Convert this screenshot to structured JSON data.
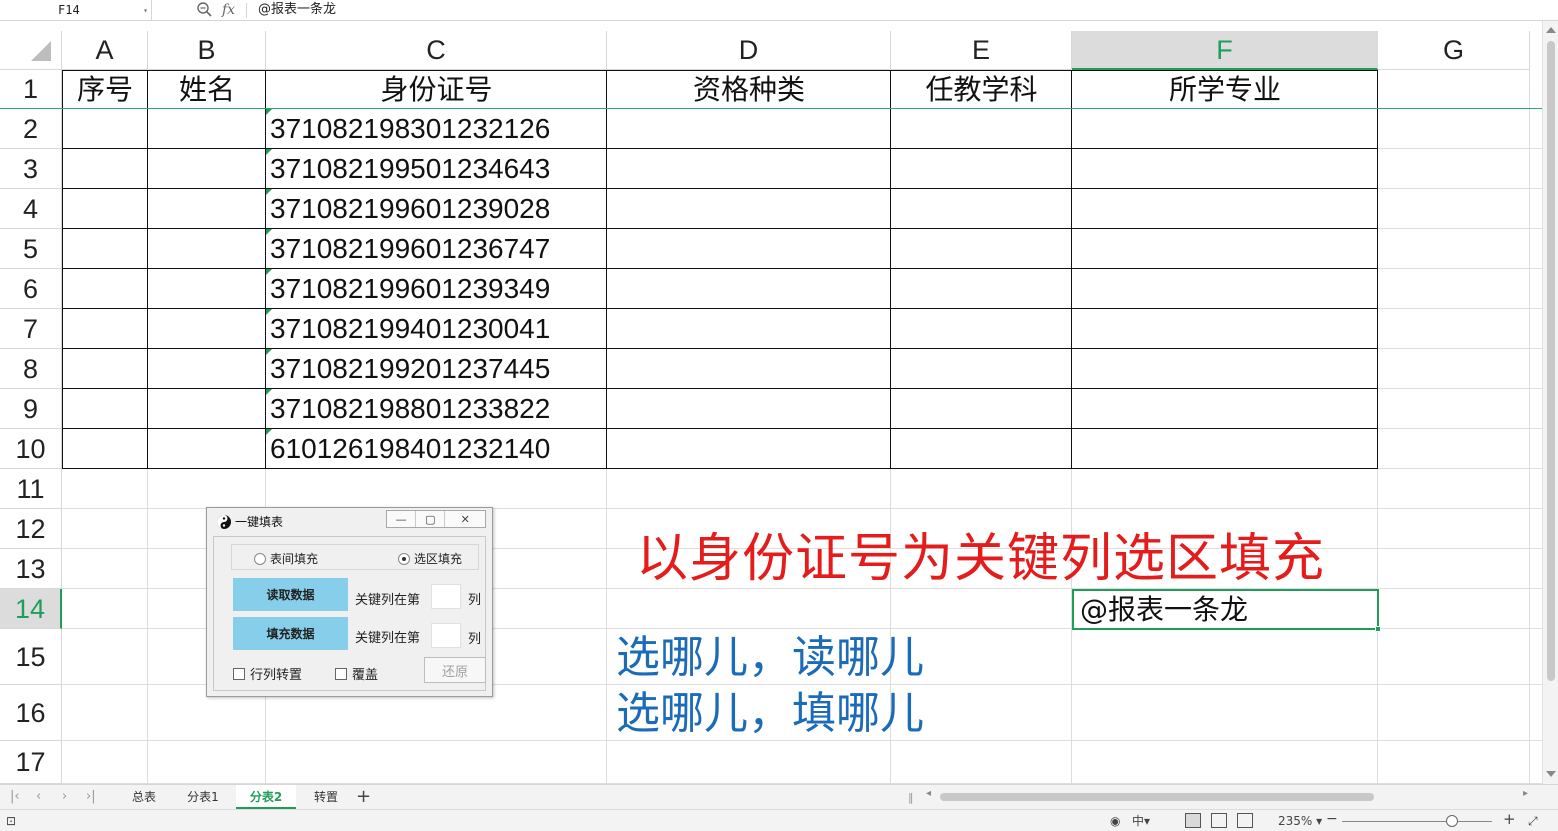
{
  "formula_bar": {
    "cell_ref": "F14",
    "fx_label": "fx",
    "content": "@报表一条龙"
  },
  "columns": [
    "A",
    "B",
    "C",
    "D",
    "E",
    "F",
    "G"
  ],
  "active_column": "F",
  "rows": [
    "1",
    "2",
    "3",
    "4",
    "5",
    "6",
    "7",
    "8",
    "9",
    "10",
    "11",
    "12",
    "13",
    "14",
    "15",
    "16",
    "17"
  ],
  "active_row": "14",
  "table": {
    "headers": [
      "序号",
      "姓名",
      "身份证号",
      "资格种类",
      "任教学科",
      "所学专业"
    ],
    "id_numbers": [
      "371082198301232126",
      "371082199501234643",
      "371082199601239028",
      "371082199601236747",
      "371082199601239349",
      "371082199401230041",
      "371082199201237445",
      "371082198801233822",
      "610126198401232140"
    ]
  },
  "annotations": {
    "title_red": "以身份证号为关键列选区填充",
    "line1": "选哪儿，读哪儿",
    "line2": "选哪儿，填哪儿",
    "selected_cell_text": "@报表一条龙"
  },
  "dialog": {
    "title": "一键填表",
    "radio_options": [
      {
        "label": "表间填充",
        "checked": false
      },
      {
        "label": "选区填充",
        "checked": true
      }
    ],
    "read_button": "读取数据",
    "fill_button": "填充数据",
    "key_col_label": "关键列在第",
    "col_unit": "列",
    "read_key_col_value": "",
    "fill_key_col_value": "",
    "transpose_label": "行列转置",
    "overwrite_label": "覆盖",
    "restore_button": "还原"
  },
  "sheet_tabs": [
    "总表",
    "分表1",
    "分表2",
    "转置"
  ],
  "active_sheet": "分表2",
  "status": {
    "ime": "中",
    "zoom": "235%"
  },
  "colors": {
    "accent_green": "#1f9e5a",
    "title_red": "#e41c1c",
    "note_blue": "#1c6bb8",
    "button_blue": "#87ceeb"
  }
}
